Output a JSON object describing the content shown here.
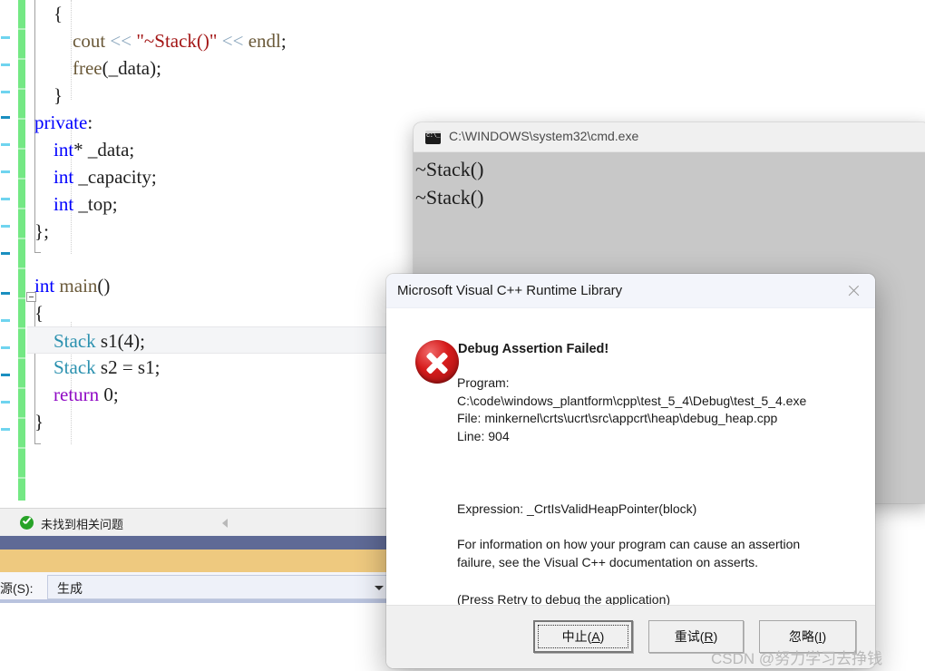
{
  "editor": {
    "lines": [
      [
        {
          "t": "    ",
          "c": "plain"
        },
        {
          "t": "{",
          "c": "brace"
        }
      ],
      [
        {
          "t": "        ",
          "c": "plain"
        },
        {
          "t": "cout",
          "c": "fn"
        },
        {
          "t": " ",
          "c": "plain"
        },
        {
          "t": "<<",
          "c": "op"
        },
        {
          "t": " ",
          "c": "plain"
        },
        {
          "t": "\"~Stack()\"",
          "c": "str"
        },
        {
          "t": " ",
          "c": "plain"
        },
        {
          "t": "<<",
          "c": "op"
        },
        {
          "t": " ",
          "c": "plain"
        },
        {
          "t": "endl",
          "c": "fn"
        },
        {
          "t": ";",
          "c": "plain"
        }
      ],
      [
        {
          "t": "        ",
          "c": "plain"
        },
        {
          "t": "free",
          "c": "fn"
        },
        {
          "t": "(_data);",
          "c": "plain"
        }
      ],
      [
        {
          "t": "    ",
          "c": "plain"
        },
        {
          "t": "}",
          "c": "brace"
        }
      ],
      [
        {
          "t": "private",
          "c": "kw"
        },
        {
          "t": ":",
          "c": "plain"
        }
      ],
      [
        {
          "t": "    ",
          "c": "plain"
        },
        {
          "t": "int",
          "c": "kw"
        },
        {
          "t": "* _data;",
          "c": "plain"
        }
      ],
      [
        {
          "t": "    ",
          "c": "plain"
        },
        {
          "t": "int",
          "c": "kw"
        },
        {
          "t": " _capacity;",
          "c": "plain"
        }
      ],
      [
        {
          "t": "    ",
          "c": "plain"
        },
        {
          "t": "int",
          "c": "kw"
        },
        {
          "t": " _top;",
          "c": "plain"
        }
      ],
      [
        {
          "t": "};",
          "c": "brace"
        }
      ],
      [
        {
          "t": "",
          "c": "plain"
        }
      ],
      [
        {
          "t": "int",
          "c": "kw"
        },
        {
          "t": " ",
          "c": "plain"
        },
        {
          "t": "main",
          "c": "fn"
        },
        {
          "t": "()",
          "c": "plain"
        }
      ],
      [
        {
          "t": "{",
          "c": "brace"
        }
      ],
      [
        {
          "t": "    ",
          "c": "plain"
        },
        {
          "t": "Stack",
          "c": "typ"
        },
        {
          "t": " s1(",
          "c": "plain"
        },
        {
          "t": "4",
          "c": "num"
        },
        {
          "t": ");",
          "c": "plain"
        }
      ],
      [
        {
          "t": "    ",
          "c": "plain"
        },
        {
          "t": "Stack",
          "c": "typ"
        },
        {
          "t": " s2 = s1;",
          "c": "plain"
        }
      ],
      [
        {
          "t": "    ",
          "c": "plain"
        },
        {
          "t": "return",
          "c": "ctrl"
        },
        {
          "t": " ",
          "c": "plain"
        },
        {
          "t": "0",
          "c": "num"
        },
        {
          "t": ";",
          "c": "plain"
        }
      ],
      [
        {
          "t": "}",
          "c": "brace"
        }
      ]
    ],
    "highlighted_line_index": 12
  },
  "error_list": {
    "status_text": "未找到相关问题",
    "ok_icon": "check-circle-icon",
    "collapse_icon": "caret-left-icon"
  },
  "output_source": {
    "label": "源(S):",
    "value": "生成",
    "dropdown_icon": "chevron-down-icon"
  },
  "cmd_window": {
    "icon": "console-icon",
    "title": "C:\\WINDOWS\\system32\\cmd.exe",
    "output": "~Stack()\n~Stack()"
  },
  "dialog": {
    "title": "Microsoft Visual C++ Runtime Library",
    "close_icon": "close-icon",
    "error_icon": "error-circle-icon",
    "heading": "Debug Assertion Failed!",
    "details": "Program:\nC:\\code\\windows_plantform\\cpp\\test_5_4\\Debug\\test_5_4.exe\nFile: minkernel\\crts\\ucrt\\src\\appcrt\\heap\\debug_heap.cpp\nLine: 904",
    "expression": "Expression: _CrtIsValidHeapPointer(block)",
    "information": "For information on how your program can cause an assertion\nfailure, see the Visual C++ documentation on asserts.",
    "hint": "(Press Retry to debug the application)",
    "buttons": [
      {
        "text_before": "中止(",
        "accel": "A",
        "text_after": ")",
        "name": "abort-button",
        "default": true
      },
      {
        "text_before": "重试(",
        "accel": "R",
        "text_after": ")",
        "name": "retry-button",
        "default": false
      },
      {
        "text_before": "忽略(",
        "accel": "I",
        "text_after": ")",
        "name": "ignore-button",
        "default": false
      }
    ]
  },
  "watermark": {
    "text": "CSDN @努力学习去挣钱"
  },
  "colors": {
    "keyword": "#0000ff",
    "type": "#2b91af",
    "string": "#a31515",
    "control": "#8f08c4",
    "function": "#6b5a3a",
    "operator": "#8aa6bd",
    "change_bar": "#74e884",
    "band_blue": "#5f6a96",
    "band_orange": "#eec97f",
    "error_red": "#d71c1c"
  }
}
